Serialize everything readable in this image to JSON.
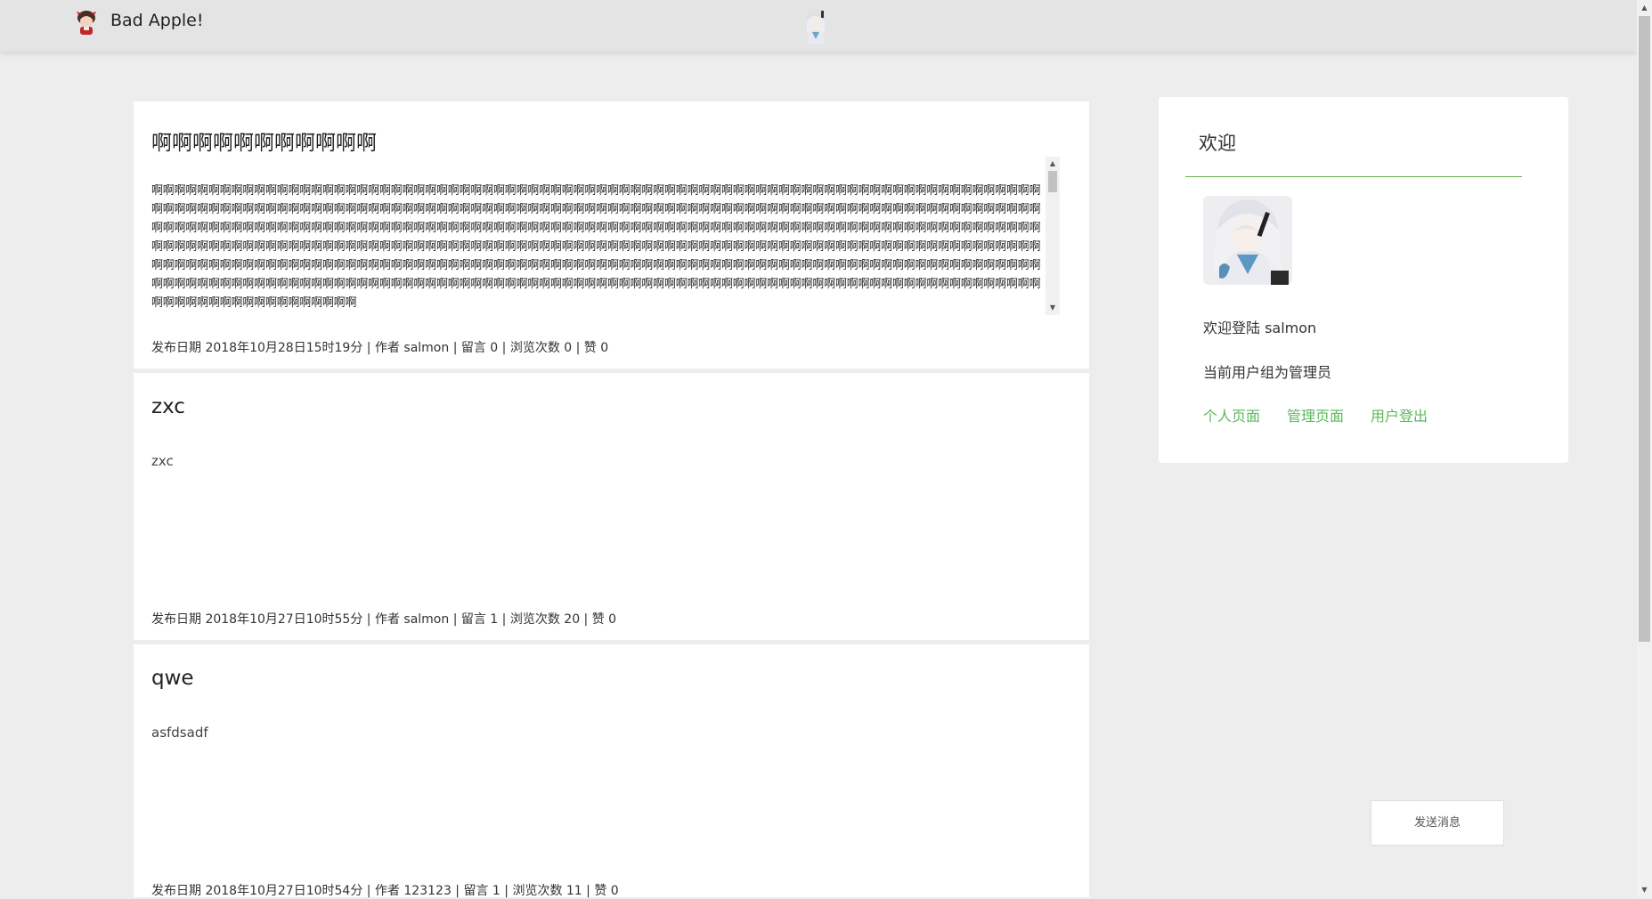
{
  "header": {
    "site_title": "Bad Apple!",
    "logo_icon": "reimu-avatar-icon",
    "center_icon": "character-avatar-icon"
  },
  "posts": [
    {
      "title": "啊啊啊啊啊啊啊啊啊啊啊",
      "body": "啊啊啊啊啊啊啊啊啊啊啊啊啊啊啊啊啊啊啊啊啊啊啊啊啊啊啊啊啊啊啊啊啊啊啊啊啊啊啊啊啊啊啊啊啊啊啊啊啊啊啊啊啊啊啊啊啊啊啊啊啊啊啊啊啊啊啊啊啊啊啊啊啊啊啊啊啊啊啊啊啊啊啊啊啊啊啊啊啊啊啊啊啊啊啊啊啊啊啊啊啊啊啊啊啊啊啊啊啊啊啊啊啊啊啊啊啊啊啊啊啊啊啊啊啊啊啊啊啊啊啊啊啊啊啊啊啊啊啊啊啊啊啊啊啊啊啊啊啊啊啊啊啊啊啊啊啊啊啊啊啊啊啊啊啊啊啊啊啊啊啊啊啊啊啊啊啊啊啊啊啊啊啊啊啊啊啊啊啊啊啊啊啊啊啊啊啊啊啊啊啊啊啊啊啊啊啊啊啊啊啊啊啊啊啊啊啊啊啊啊啊啊啊啊啊啊啊啊啊啊啊啊啊啊啊啊啊啊啊啊啊啊啊啊啊啊啊啊啊啊啊啊啊啊啊啊啊啊啊啊啊啊啊啊啊啊啊啊啊啊啊啊啊啊啊啊啊啊啊啊啊啊啊啊啊啊啊啊啊啊啊啊啊啊啊啊啊啊啊啊啊啊啊啊啊啊啊啊啊啊啊啊啊啊啊啊啊啊啊啊啊啊啊啊啊啊啊啊啊啊啊啊啊啊啊啊啊啊啊啊啊啊啊啊啊啊啊啊啊啊啊啊啊啊啊啊啊啊啊啊啊啊啊啊啊啊啊啊啊啊啊啊啊啊啊啊啊啊啊啊啊啊啊啊啊啊啊啊啊啊啊啊啊啊啊啊啊啊啊啊啊啊啊啊啊啊啊啊啊啊啊啊啊啊啊啊啊啊啊啊啊啊啊啊啊啊啊啊啊啊啊啊啊啊啊啊啊啊啊啊啊啊啊啊啊啊啊啊啊啊啊啊啊啊啊啊啊啊啊啊啊啊啊啊啊啊啊啊啊啊啊啊啊啊啊啊啊啊啊啊啊啊啊啊啊啊",
      "meta": "发布日期 2018年10月28日15时19分 | 作者 salmon | 留言 0 | 浏览次数 0 | 赞 0"
    },
    {
      "title": "zxc",
      "body": "zxc",
      "meta": "发布日期 2018年10月27日10时55分 | 作者 salmon | 留言 1 | 浏览次数 20 | 赞 0"
    },
    {
      "title": "qwe",
      "body": "asfdsadf",
      "meta": "发布日期 2018年10月27日10时54分 | 作者 123123 | 留言 1 | 浏览次数 11 | 赞 0"
    }
  ],
  "sidebar": {
    "title": "欢迎",
    "welcome_text": "欢迎登陆 salmon",
    "group_text": "当前用户组为管理员",
    "links": [
      "个人页面",
      "管理页面",
      "用户登出"
    ],
    "avatar_icon": "user-avatar-icon",
    "accent_color": "#5cb85c"
  },
  "send_message_label": "发送消息"
}
